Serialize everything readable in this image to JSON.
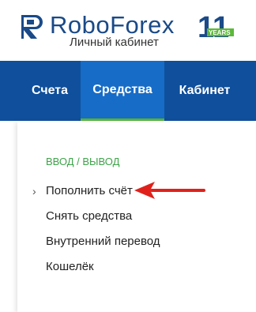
{
  "header": {
    "brand_name": "RoboForex",
    "subtitle": "Личный кабинет",
    "badge_number": "11",
    "badge_text": "YEARS"
  },
  "nav": {
    "tabs": [
      {
        "label": "Счета"
      },
      {
        "label": "Средства"
      },
      {
        "label": "Кабинет"
      }
    ]
  },
  "menu": {
    "section_heading": "ввод / вывод",
    "items": [
      {
        "label": "Пополнить счёт"
      },
      {
        "label": "Снять средства"
      },
      {
        "label": "Внутренний перевод"
      },
      {
        "label": "Кошелёк"
      }
    ],
    "chevron": "›"
  },
  "colors": {
    "brand_blue": "#1a4a88",
    "nav_bg": "#0f4f9c",
    "nav_active_bg": "#176cc7",
    "active_underline": "#59b638",
    "section_green": "#3ea34a",
    "arrow_red": "#e0211b"
  },
  "icons": {
    "logo": "roboforex-logo-icon",
    "badge": "eleven-years-badge-icon",
    "chevron": "chevron-right-icon",
    "pointer": "red-arrow-icon"
  }
}
